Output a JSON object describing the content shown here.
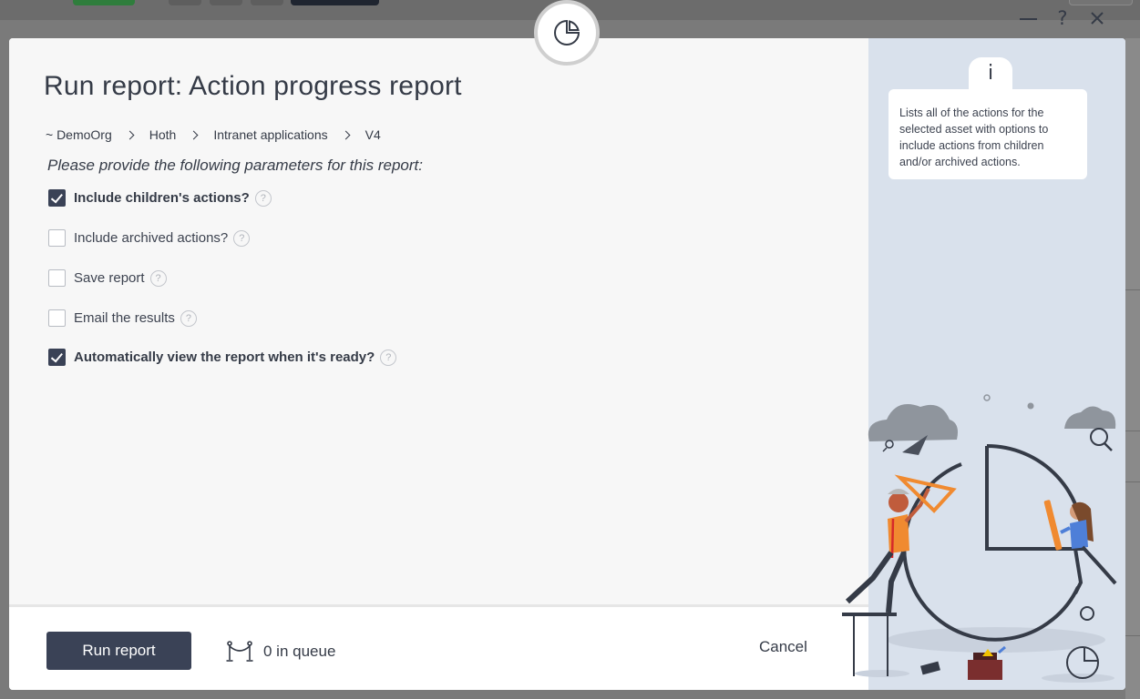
{
  "modal": {
    "title": "Run report: Action progress report",
    "breadcrumb": [
      "~ DemoOrg",
      "Hoth",
      "Intranet applications",
      "V4"
    ],
    "prompt": "Please provide the following parameters for this report:",
    "parameters": [
      {
        "label": "Include children's actions?",
        "checked": true
      },
      {
        "label": "Include archived actions?",
        "checked": false
      },
      {
        "label": "Save report",
        "checked": false
      },
      {
        "label": "Email the results",
        "checked": false
      },
      {
        "label": "Automatically view the report when it's ready?",
        "checked": true
      }
    ],
    "help_glyph": "?",
    "footer": {
      "run_label": "Run report",
      "queue_text": "0 in queue",
      "cancel_label": "Cancel"
    },
    "window_controls": {
      "help": "?",
      "close": "✕"
    },
    "info": {
      "glyph": "i",
      "text": "Lists all of the actions for the selected asset with options to include actions from children and/or archived actions."
    }
  },
  "icons": {
    "report_badge": "pie-chart-icon",
    "queue": "queue-stanchion-icon"
  },
  "colors": {
    "primary_dark": "#3a4256",
    "side_panel": "#d9e1ec",
    "illustration_orange": "#f08a30"
  }
}
